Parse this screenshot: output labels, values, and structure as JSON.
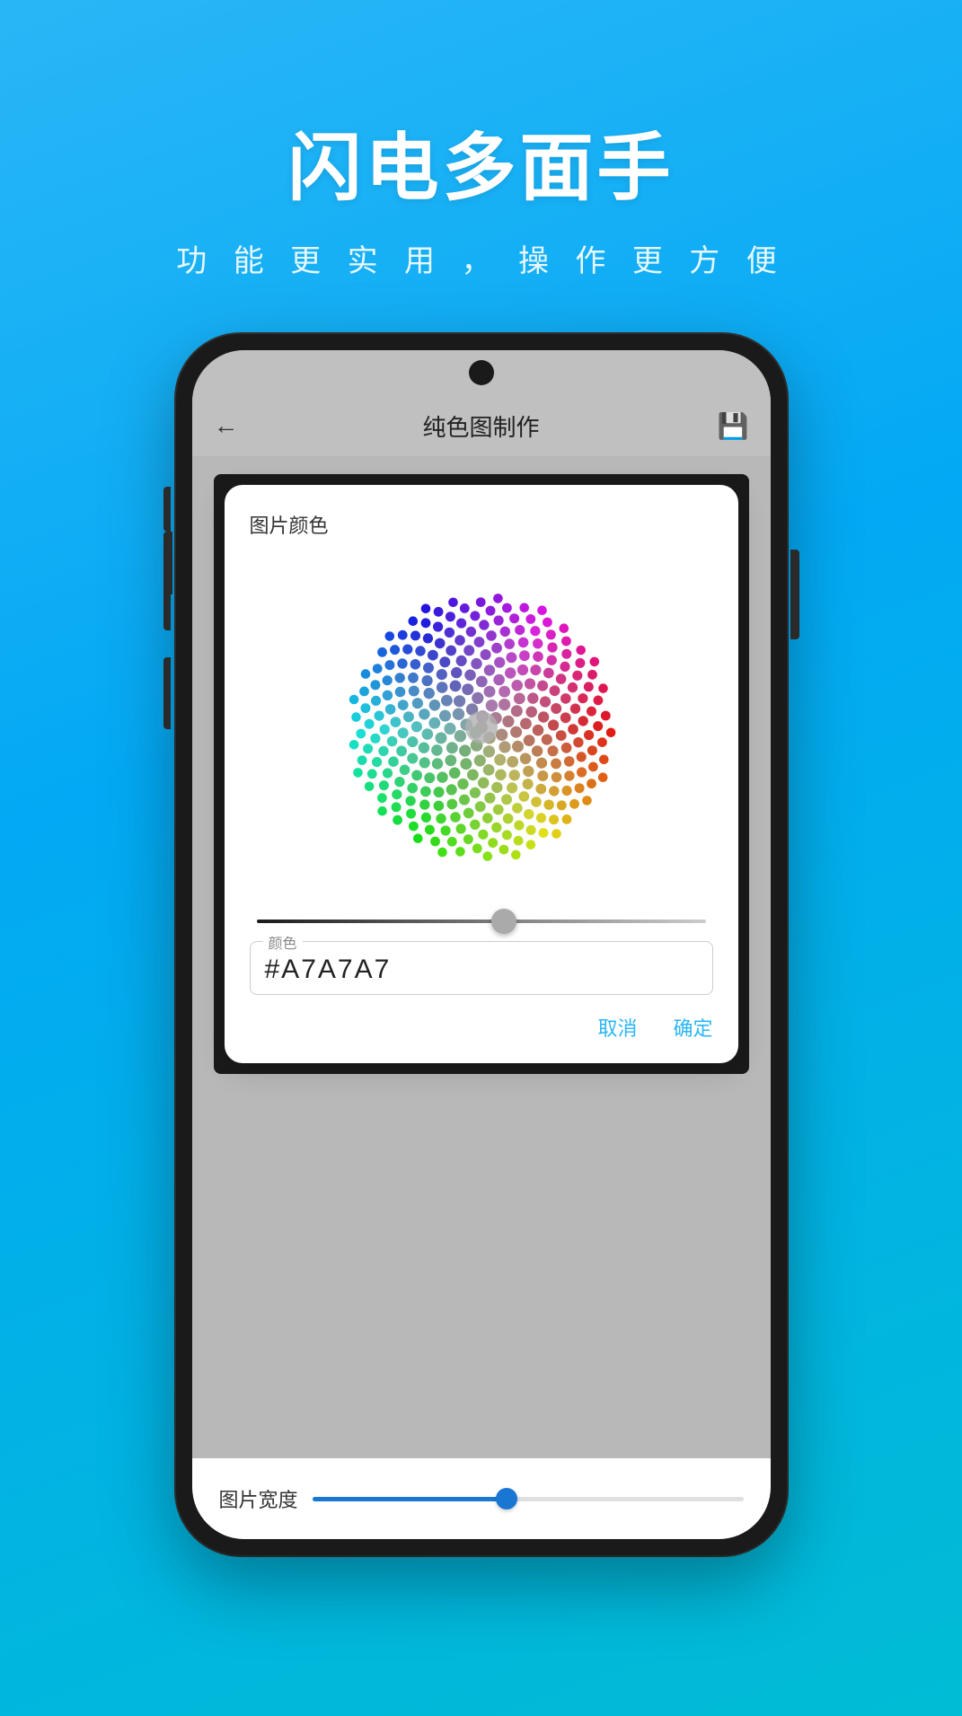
{
  "header": {
    "title": "闪电多面手",
    "subtitle": "功 能 更 实 用 ， 操 作 更 方 便"
  },
  "phone": {
    "app_bar": {
      "back_label": "←",
      "title": "纯色图制作",
      "save_icon": "💾"
    },
    "dialog": {
      "title": "图片颜色",
      "color_label": "颜色",
      "color_value": "#A7A7A7",
      "cancel_label": "取消",
      "confirm_label": "确定"
    },
    "bottom_bar": {
      "label": "图片宽度"
    }
  }
}
